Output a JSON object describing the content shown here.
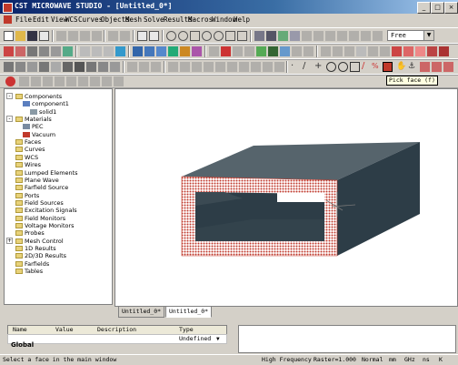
{
  "window": {
    "title": "CST MICROWAVE STUDIO - [Untitled_0*]"
  },
  "menu": [
    "File",
    "Edit",
    "View",
    "WCS",
    "Curves",
    "Objects",
    "Mesh",
    "Solve",
    "Results",
    "Macros",
    "Window",
    "Help"
  ],
  "toolbar": {
    "mode_value": "Free",
    "pick_face_tooltip": "Pick face (f)"
  },
  "tree": {
    "items": [
      {
        "label": "Components",
        "level": 0,
        "expanded": true,
        "icon": "folder-icon"
      },
      {
        "label": "component1",
        "level": 1,
        "expanded": true,
        "icon": "component-icon"
      },
      {
        "label": "solid1",
        "level": 2,
        "icon": "solid-icon"
      },
      {
        "label": "Materials",
        "level": 0,
        "expanded": true,
        "icon": "folder-icon"
      },
      {
        "label": "PEC",
        "level": 1,
        "icon": "material-pec-icon"
      },
      {
        "label": "Vacuum",
        "level": 1,
        "icon": "material-vacuum-icon"
      },
      {
        "label": "Faces",
        "level": 0,
        "icon": "folder-icon"
      },
      {
        "label": "Curves",
        "level": 0,
        "icon": "folder-icon"
      },
      {
        "label": "WCS",
        "level": 0,
        "icon": "folder-icon"
      },
      {
        "label": "Wires",
        "level": 0,
        "icon": "folder-icon"
      },
      {
        "label": "Lumped Elements",
        "level": 0,
        "icon": "folder-icon"
      },
      {
        "label": "Plane Wave",
        "level": 0,
        "icon": "folder-icon"
      },
      {
        "label": "Farfield Source",
        "level": 0,
        "icon": "folder-icon"
      },
      {
        "label": "Ports",
        "level": 0,
        "icon": "folder-icon"
      },
      {
        "label": "Field Sources",
        "level": 0,
        "icon": "folder-icon"
      },
      {
        "label": "Excitation Signals",
        "level": 0,
        "icon": "folder-icon"
      },
      {
        "label": "Field Monitors",
        "level": 0,
        "icon": "folder-icon"
      },
      {
        "label": "Voltage Monitors",
        "level": 0,
        "icon": "folder-icon"
      },
      {
        "label": "Probes",
        "level": 0,
        "icon": "folder-icon"
      },
      {
        "label": "Mesh Control",
        "level": 0,
        "collapsed": true,
        "icon": "folder-icon"
      },
      {
        "label": "1D Results",
        "level": 0,
        "icon": "folder-icon"
      },
      {
        "label": "2D/3D Results",
        "level": 0,
        "icon": "folder-icon"
      },
      {
        "label": "Farfields",
        "level": 0,
        "icon": "folder-icon"
      },
      {
        "label": "Tables",
        "level": 0,
        "icon": "folder-icon"
      }
    ]
  },
  "tabs": [
    "Untitled_0*",
    "Untitled_0*"
  ],
  "params": {
    "col_name": "Name",
    "col_value": "Value",
    "col_desc": "Description",
    "col_type": "Type",
    "row_type": "Undefined",
    "tab_global": "Global"
  },
  "status": {
    "message": "Select a face in the main window",
    "solver": "High Frequency",
    "raster": "Raster=1.000",
    "mode": "Normal",
    "u1": "mm",
    "u2": "GHz",
    "u3": "ns",
    "u4": "K"
  },
  "colors": {
    "box_dark": "#2d3d47",
    "box_top": "#56646c",
    "pick_dots": "#c0392b",
    "title_bar": "#0a246a"
  }
}
